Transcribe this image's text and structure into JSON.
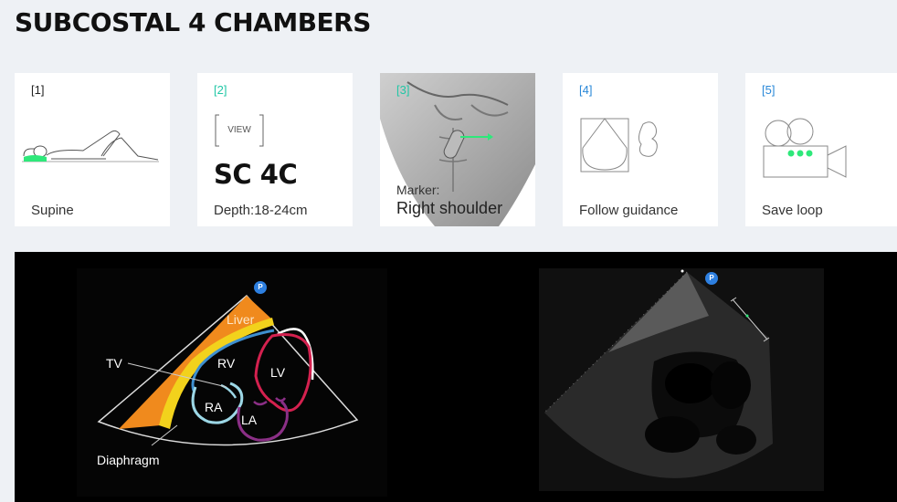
{
  "page": {
    "title": "SUBCOSTAL 4 CHAMBERS"
  },
  "steps": [
    {
      "number": "[1]",
      "caption": "Supine",
      "number_color": "#222222",
      "icon": "supine-patient-icon"
    },
    {
      "number": "[2]",
      "view_label": "VIEW",
      "view_name": "SC 4C",
      "caption": "Depth:18-24cm",
      "number_color": "#22c7a6"
    },
    {
      "number": "[3]",
      "marker_label": "Marker:",
      "marker_value": "Right shoulder",
      "number_color": "#22c7a6",
      "icon": "torso-probe-marker-image"
    },
    {
      "number": "[4]",
      "caption": "Follow guidance",
      "number_color": "#2a88d8",
      "icon": "probe-guidance-icon"
    },
    {
      "number": "[5]",
      "caption": "Save loop",
      "number_color": "#2a88d8",
      "icon": "video-camera-icon"
    }
  ],
  "diagram": {
    "badge": "P",
    "labels": {
      "liver": "Liver",
      "tv": "TV",
      "rv": "RV",
      "lv": "LV",
      "ra": "RA",
      "la": "LA",
      "diaphragm": "Diaphragm"
    },
    "colors": {
      "liver": "#f08a1d",
      "diaphragm": "#f2d21c",
      "rv": "#3e8fcf",
      "lv": "#d4214f",
      "ra": "#9cd7e6",
      "la": "#8b2f86",
      "accent": "#2ee87a"
    }
  },
  "ultrasound": {
    "badge": "P"
  }
}
